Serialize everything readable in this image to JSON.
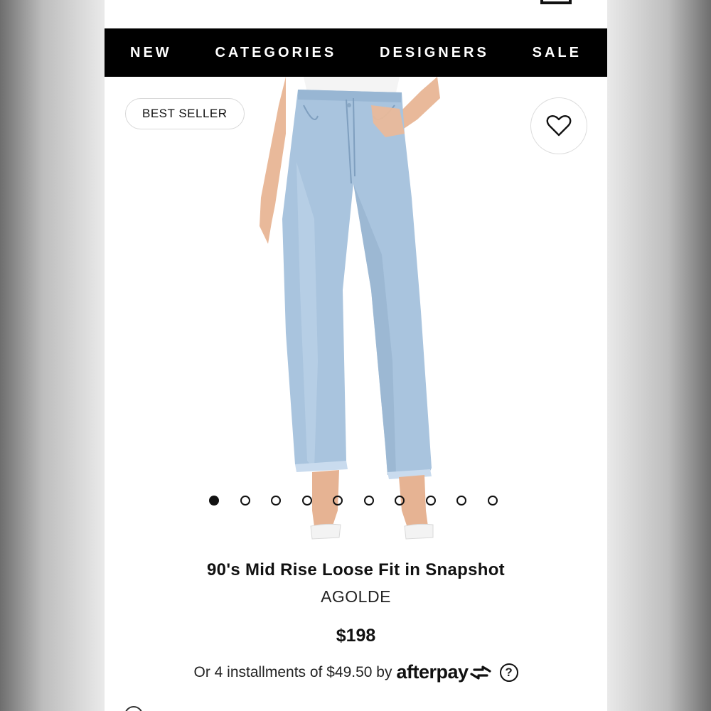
{
  "nav": {
    "items": [
      {
        "label": "NEW"
      },
      {
        "label": "CATEGORIES"
      },
      {
        "label": "DESIGNERS"
      },
      {
        "label": "SALE"
      }
    ]
  },
  "header": {
    "icons": [
      "search-icon",
      "shopping-bag-icon"
    ]
  },
  "product": {
    "badge": "BEST SELLER",
    "title": "90's Mid Rise Loose Fit in Snapshot",
    "brand": "AGOLDE",
    "price": "$198",
    "installments_text": "Or 4 installments of $49.50 by",
    "afterpay_label": "afterpay",
    "help_label": "?",
    "gallery": {
      "count": 10,
      "active_index": 0
    }
  },
  "colors": {
    "nav_background": "#000000",
    "nav_text": "#ffffff",
    "denim": "#a9c4de"
  }
}
